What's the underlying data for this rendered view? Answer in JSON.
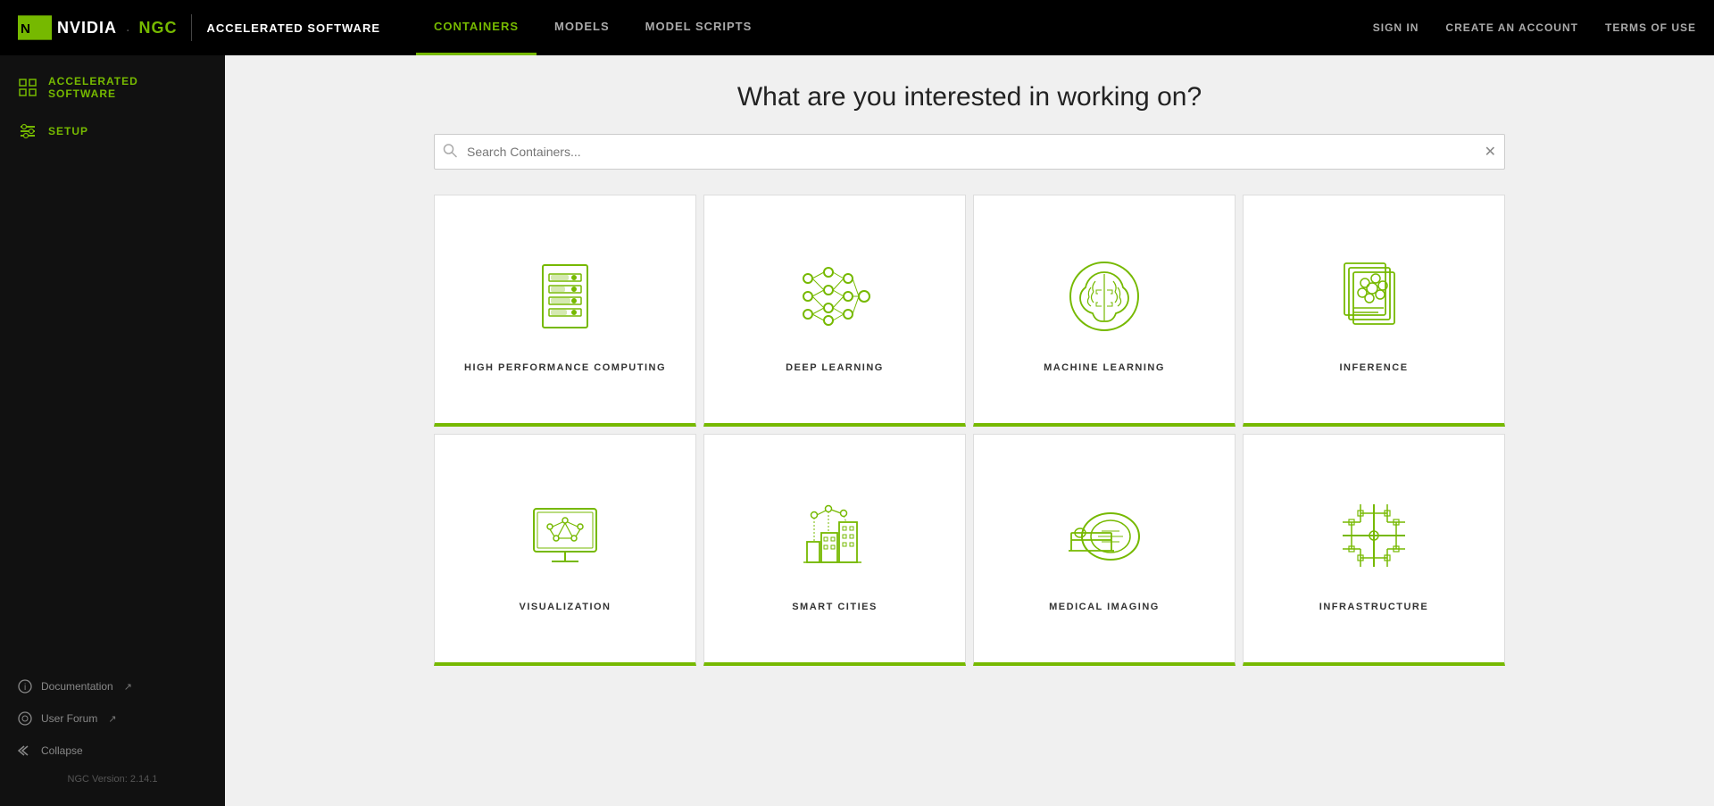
{
  "topNav": {
    "brand": "ACCELERATED SOFTWARE",
    "links": [
      {
        "id": "containers",
        "label": "CONTAINERS",
        "active": true
      },
      {
        "id": "models",
        "label": "MODELS",
        "active": false
      },
      {
        "id": "model-scripts",
        "label": "MODEL SCRIPTS",
        "active": false
      }
    ],
    "rightLinks": [
      {
        "id": "sign-in",
        "label": "SIGN IN"
      },
      {
        "id": "create-account",
        "label": "CREATE AN ACCOUNT"
      },
      {
        "id": "terms",
        "label": "TERMS OF USE"
      }
    ]
  },
  "sidebar": {
    "topItems": [
      {
        "id": "accelerated-software",
        "label": "ACCELERATED SOFTWARE",
        "icon": "grid-icon"
      },
      {
        "id": "setup",
        "label": "SETUP",
        "icon": "setup-icon"
      }
    ],
    "bottomItems": [
      {
        "id": "documentation",
        "label": "Documentation",
        "icon": "info-icon"
      },
      {
        "id": "user-forum",
        "label": "User Forum",
        "icon": "chat-icon"
      }
    ],
    "collapseLabel": "Collapse",
    "version": "NGC Version: 2.14.1"
  },
  "page": {
    "title": "What are you interested in working on?",
    "searchPlaceholder": "Search Containers..."
  },
  "categories": [
    {
      "id": "hpc",
      "label": "HIGH PERFORMANCE COMPUTING",
      "icon": "server-icon"
    },
    {
      "id": "deep-learning",
      "label": "DEEP LEARNING",
      "icon": "neural-network-icon"
    },
    {
      "id": "machine-learning",
      "label": "MACHINE LEARNING",
      "icon": "brain-icon"
    },
    {
      "id": "inference",
      "label": "INFERENCE",
      "icon": "flower-icon"
    },
    {
      "id": "visualization",
      "label": "VISUALIZATION",
      "icon": "monitor-icon"
    },
    {
      "id": "smart-cities",
      "label": "SMART CITIES",
      "icon": "city-icon"
    },
    {
      "id": "medical-imaging",
      "label": "MEDICAL IMAGING",
      "icon": "mri-icon"
    },
    {
      "id": "infrastructure",
      "label": "INFRASTRUCTURE",
      "icon": "circuit-icon"
    }
  ]
}
